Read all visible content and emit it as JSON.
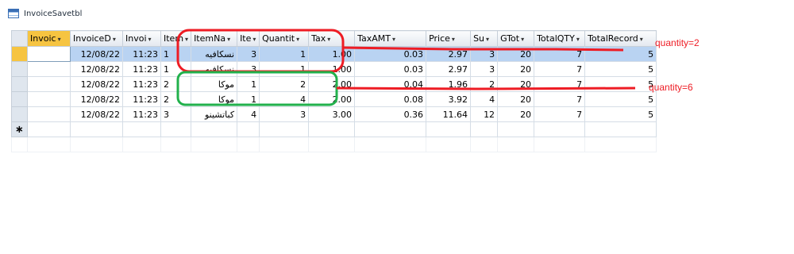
{
  "window": {
    "title": "InvoiceSavetbl"
  },
  "table": {
    "columns": [
      {
        "label": "Invoic",
        "arrow": "▾"
      },
      {
        "label": "InvoiceD",
        "arrow": "▾"
      },
      {
        "label": "Invoi",
        "arrow": "▾"
      },
      {
        "label": "Item",
        "arrow": "▾"
      },
      {
        "label": "ItemNa",
        "arrow": "▾"
      },
      {
        "label": "Ite",
        "arrow": "▾"
      },
      {
        "label": "Quantit",
        "arrow": "▾"
      },
      {
        "label": "Tax",
        "arrow": "▾"
      },
      {
        "label": "TaxAMT",
        "arrow": "▾"
      },
      {
        "label": "Price",
        "arrow": "▾"
      },
      {
        "label": "Su",
        "arrow": "▾"
      },
      {
        "label": "GTot",
        "arrow": "▾"
      },
      {
        "label": "TotalQTY",
        "arrow": "▾"
      },
      {
        "label": "TotalRecord",
        "arrow": "▾"
      }
    ],
    "rows": [
      [
        "",
        "12/08/22",
        "11:23",
        "1",
        "نسكافيه",
        "3",
        "1",
        "1.00",
        "0.03",
        "2.97",
        "3",
        "20",
        "7",
        "5"
      ],
      [
        "",
        "12/08/22",
        "11:23",
        "1",
        "نسكافيه",
        "3",
        "1",
        "1.00",
        "0.03",
        "2.97",
        "3",
        "20",
        "7",
        "5"
      ],
      [
        "",
        "12/08/22",
        "11:23",
        "2",
        "موكا",
        "1",
        "2",
        "2.00",
        "0.04",
        "1.96",
        "2",
        "20",
        "7",
        "5"
      ],
      [
        "",
        "12/08/22",
        "11:23",
        "2",
        "موكا",
        "1",
        "4",
        "2.00",
        "0.08",
        "3.92",
        "4",
        "20",
        "7",
        "5"
      ],
      [
        "",
        "12/08/22",
        "11:23",
        "3",
        "كباتشينو",
        "4",
        "3",
        "3.00",
        "0.36",
        "11.64",
        "12",
        "20",
        "7",
        "5"
      ]
    ],
    "new_row_marker": "∗",
    "active_row_index": 0
  },
  "annotations": {
    "red_label": "quantity=2",
    "green_label": "quantity=6",
    "red_color": "#ee1c24",
    "green_color": "#22b14c"
  },
  "colors": {
    "header_highlight": "#f6c441",
    "active_row": "#b9d3f2"
  }
}
